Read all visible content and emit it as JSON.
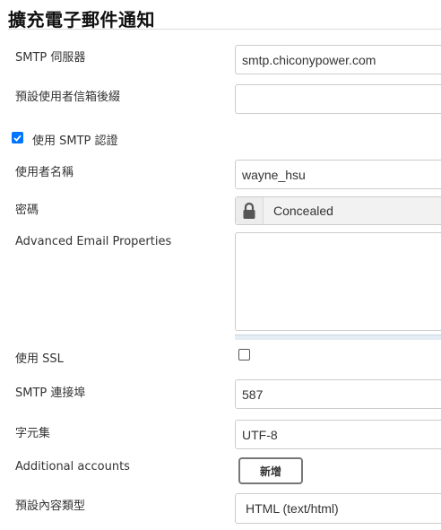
{
  "section": {
    "title": "擴充電子郵件通知"
  },
  "smtp_server": {
    "label": "SMTP 伺服器",
    "value": "smtp.chiconypower.com"
  },
  "default_user_suffix": {
    "label": "預設使用者信箱後綴",
    "value": ""
  },
  "use_smtp_auth": {
    "label": "使用 SMTP 認證",
    "checked": true
  },
  "username": {
    "label": "使用者名稱",
    "value": "wayne_hsu"
  },
  "password": {
    "label": "密碼",
    "value": "Concealed",
    "icon": "lock-icon"
  },
  "advanced_props": {
    "label": "Advanced Email Properties",
    "value": ""
  },
  "use_ssl": {
    "label": "使用 SSL",
    "checked": false
  },
  "smtp_port": {
    "label": "SMTP 連接埠",
    "value": "587"
  },
  "charset": {
    "label": "字元集",
    "value": "UTF-8"
  },
  "additional_accounts": {
    "label": "Additional accounts",
    "add_button_label": "新增"
  },
  "default_content_type": {
    "label": "預設內容類型",
    "value": "HTML (text/html)"
  },
  "colors": {
    "checkbox_accent": "#0075ff",
    "border": "#cccccc",
    "label_text": "#333333"
  }
}
